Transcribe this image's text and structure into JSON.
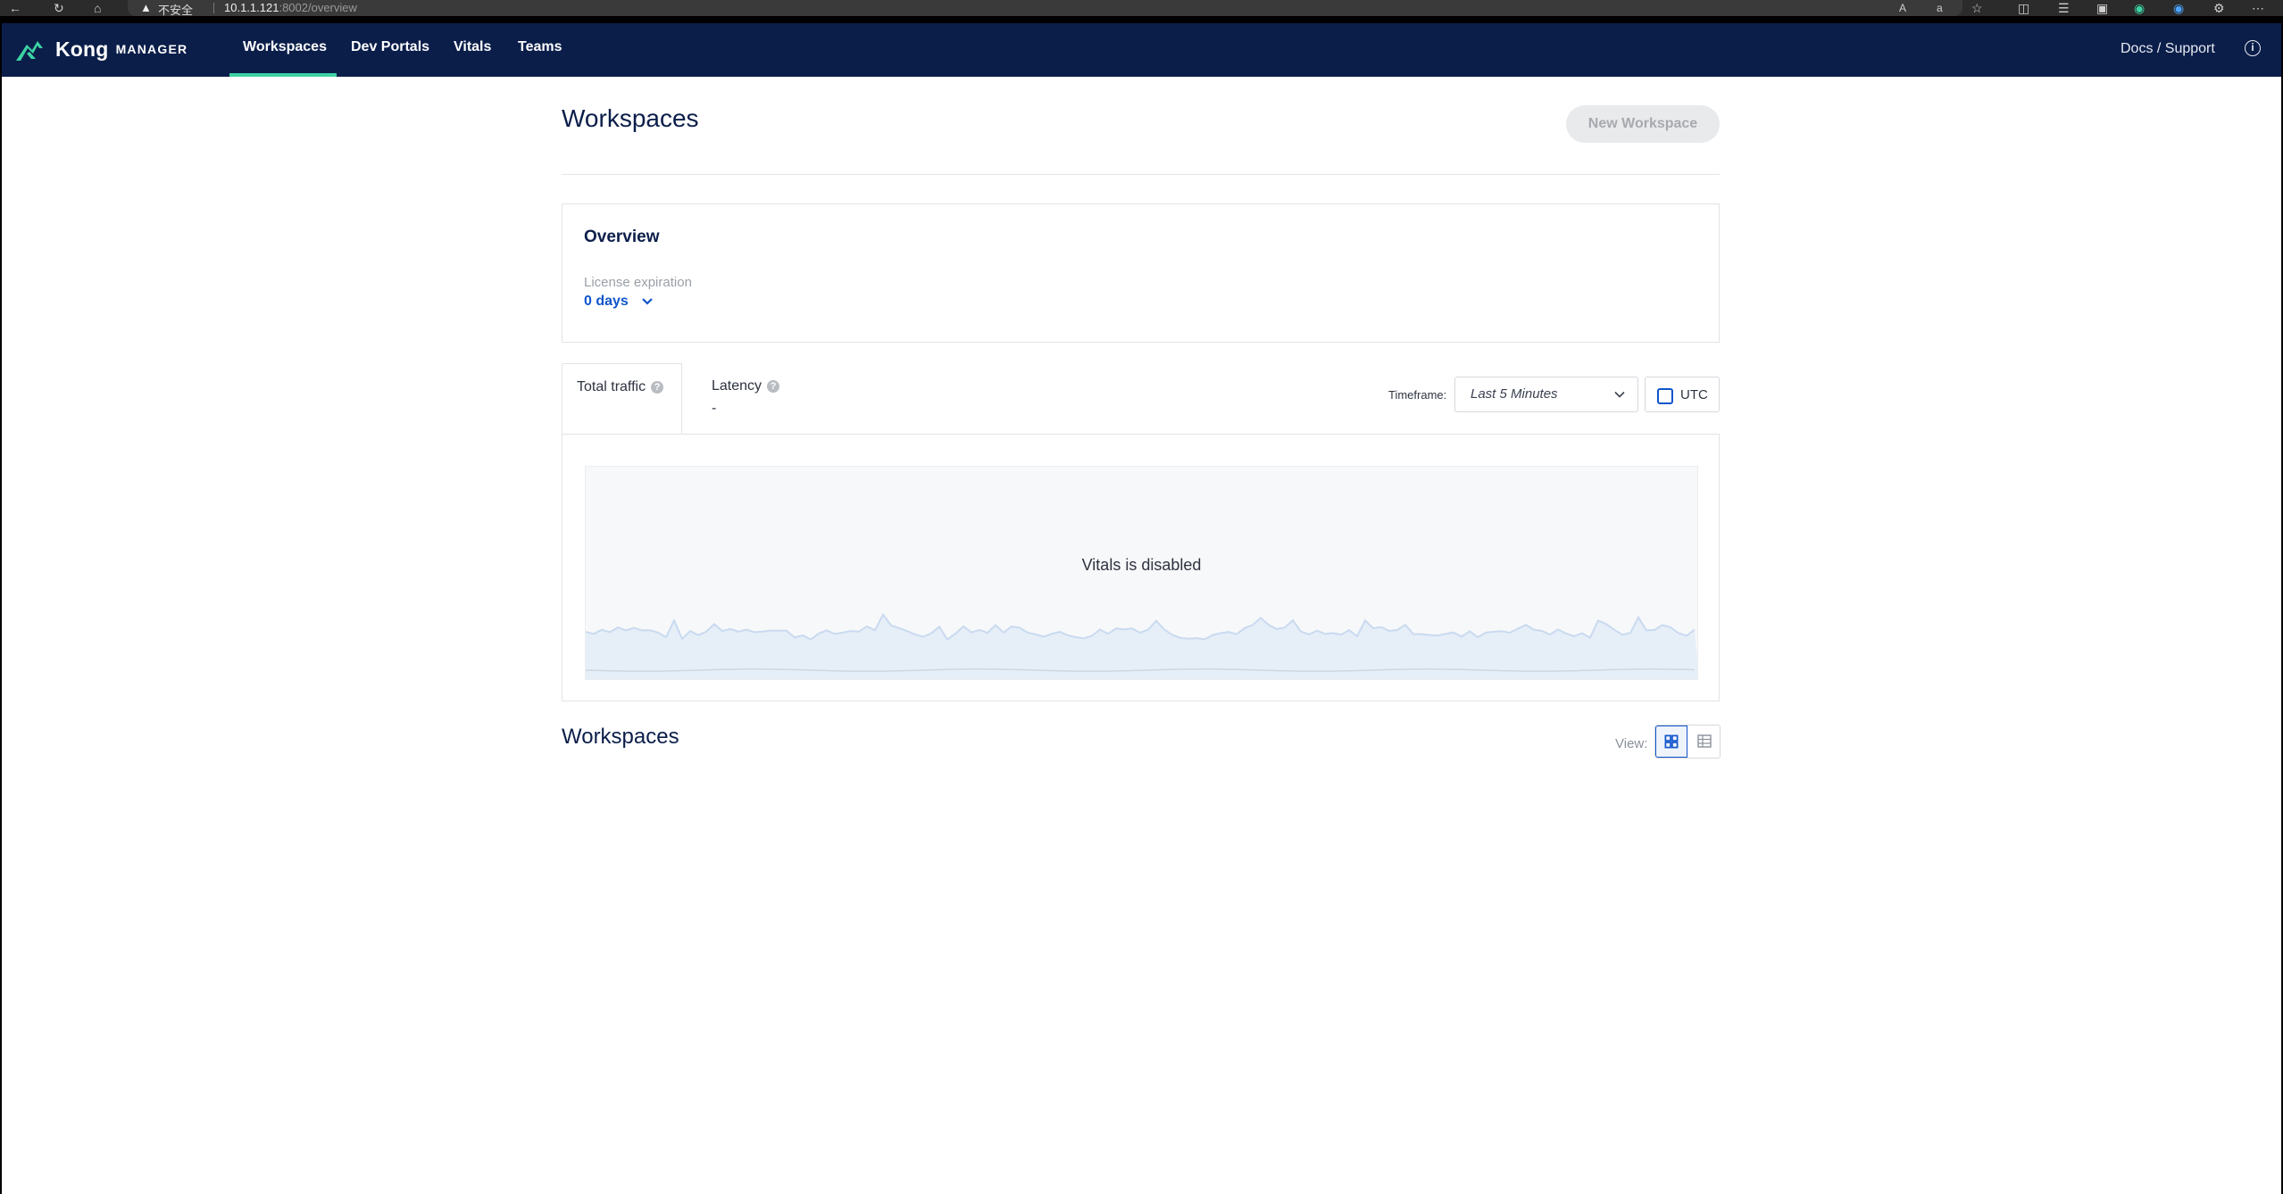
{
  "browser": {
    "insecure_label": "不安全",
    "url_host": "10.1.1.121",
    "url_rest": ":8002/overview"
  },
  "topnav": {
    "brand": "Kong",
    "brand_sub": "MANAGER",
    "items": [
      {
        "label": "Workspaces",
        "active": true
      },
      {
        "label": "Dev Portals",
        "active": false
      },
      {
        "label": "Vitals",
        "active": false
      },
      {
        "label": "Teams",
        "active": false
      }
    ],
    "docs_label": "Docs / Support"
  },
  "header": {
    "title": "Workspaces",
    "new_button": "New Workspace"
  },
  "overview": {
    "title": "Overview",
    "license_label": "License expiration",
    "license_value": "0 days"
  },
  "vitals": {
    "tabs": [
      {
        "label": "Total traffic",
        "active": true
      },
      {
        "label": "Latency",
        "value": "-"
      }
    ],
    "timeframe_label": "Timeframe:",
    "timeframe_value": "Last 5 Minutes",
    "utc_label": "UTC",
    "utc_checked": false,
    "disabled_message": "Vitals is disabled"
  },
  "workspaces_section": {
    "title": "Workspaces",
    "view_label": "View:"
  },
  "colors": {
    "nav_bg": "#0b1e4a",
    "accent": "#3dd3a4",
    "link": "#1155cb"
  }
}
